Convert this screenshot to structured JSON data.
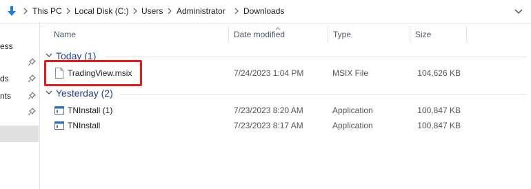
{
  "breadcrumb": [
    "This PC",
    "Local Disk (C:)",
    "Users",
    "Administrator",
    "Downloads"
  ],
  "sidebar": {
    "items": [
      "ess",
      "ds",
      "nts"
    ]
  },
  "columns": {
    "name": "Name",
    "date": "Date modified",
    "type": "Type",
    "size": "Size"
  },
  "groups": [
    {
      "label": "Today (1)",
      "files": [
        {
          "name": "TradingView.msix",
          "date": "7/24/2023 1:04 PM",
          "type": "MSIX File",
          "size": "104,626 KB",
          "icon": "document-icon"
        }
      ]
    },
    {
      "label": "Yesterday (2)",
      "files": [
        {
          "name": "TNInstall (1)",
          "date": "7/23/2023 8:20 AM",
          "type": "Application",
          "size": "100,847 KB",
          "icon": "application-icon"
        },
        {
          "name": "TNInstall",
          "date": "7/23/2023 8:17 AM",
          "type": "Application",
          "size": "100,847 KB",
          "icon": "application-icon"
        }
      ]
    }
  ],
  "colors": {
    "group_label": "#1e3f8f",
    "highlight": "#e21a1a",
    "accent": "#1e7fd8"
  }
}
